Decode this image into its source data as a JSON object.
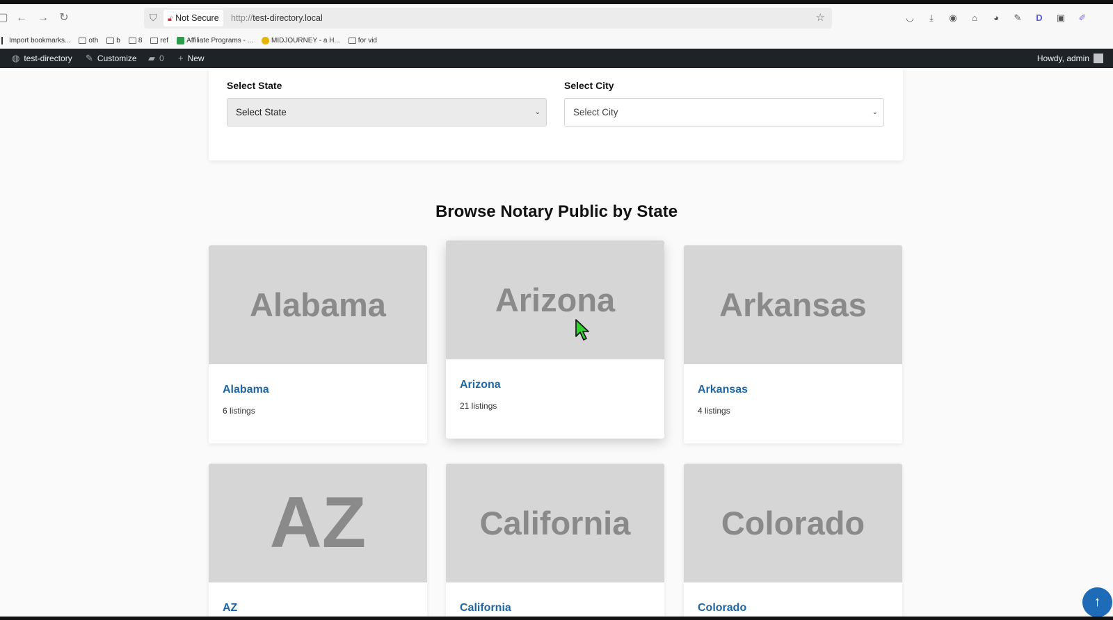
{
  "browser": {
    "security_label": "Not Secure",
    "url_protocol": "http://",
    "url_host": "test-directory.local",
    "bookmarks": [
      "Import bookmarks...",
      "oth",
      "b",
      "8",
      "ref",
      "Affiliate Programs - ...",
      "MIDJOURNEY - a H...",
      "for vid"
    ]
  },
  "adminbar": {
    "site_name": "test-directory",
    "customize": "Customize",
    "comments_count": "0",
    "new_label": "New",
    "howdy": "Howdy, admin"
  },
  "filters": {
    "state_label": "Select State",
    "state_value": "Select State",
    "city_label": "Select City",
    "city_value": "Select City"
  },
  "section_title": "Browse Notary Public by State",
  "cards": [
    {
      "image_text": "Alabama",
      "title": "Alabama",
      "count": "6 listings"
    },
    {
      "image_text": "Arizona",
      "title": "Arizona",
      "count": "21 listings"
    },
    {
      "image_text": "Arkansas",
      "title": "Arkansas",
      "count": "4 listings"
    },
    {
      "image_text": "AZ",
      "title": "AZ",
      "count": ""
    },
    {
      "image_text": "California",
      "title": "California",
      "count": ""
    },
    {
      "image_text": "Colorado",
      "title": "Colorado",
      "count": ""
    }
  ],
  "colors": {
    "link": "#1f67a3",
    "adminbar": "#1d2327",
    "scroll_button": "#1e6bb8"
  }
}
